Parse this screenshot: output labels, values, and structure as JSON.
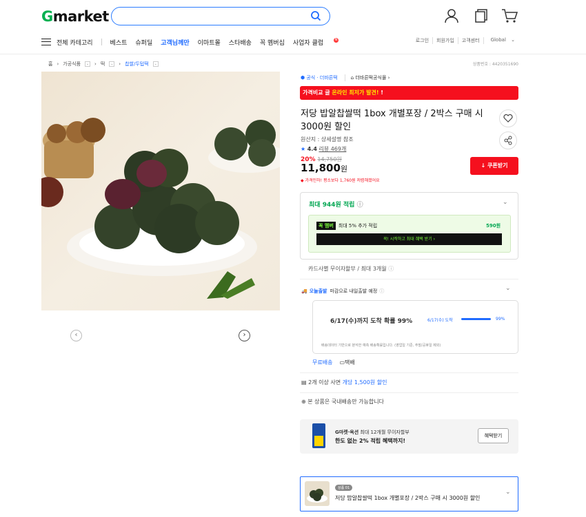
{
  "header": {
    "logo_g": "G",
    "logo_rest": "market",
    "search_placeholder": ""
  },
  "nav": {
    "all": "전체 카테고리",
    "items": [
      "베스트",
      "슈퍼딜",
      "고객님께만",
      "이마트몰",
      "스타배송",
      "꼭 멤버십",
      "사업자 클럽"
    ],
    "biz_badge": "N"
  },
  "util": [
    "로그인",
    "회원가입",
    "고객센터",
    "Global"
  ],
  "breadcrumb": [
    "홈",
    "가공식품",
    "떡",
    "찹쌀/두텁떡"
  ],
  "product_no": "상품번호 : 4420351690",
  "seller": {
    "badge": "공식 · 더바른떡",
    "shop": "더바른떡공식몰"
  },
  "banner": {
    "pre": "가격비교 글 ",
    "highlight": "온라인 최저가 발견!",
    "icon": "!"
  },
  "title": "저당 밥알찹쌀떡 1box 개별포장 / 2박스 구매 시 3000원 할인",
  "origin": "원산지 : 상세설명 참조",
  "rating": {
    "star": "★",
    "score": "4.4",
    "reviews": "리뷰 469개"
  },
  "price": {
    "discount": "20%",
    "original": "14,750원",
    "current": "11,800",
    "unit": "원",
    "lowest_note": "가격인하! 평소보다 1,760원 저렴해졌어요"
  },
  "coupon": "쿠폰받기",
  "points": {
    "title": "최대 944원 적립",
    "smile_logo": "꼭 멤버",
    "smile_text": "최대 5% 추가 적립",
    "smile_amount": "590원",
    "cta": "꼭! 시작하고 최대 혜택 받기 ›"
  },
  "card": "카드사별 무이자할부 / 최대 3개월",
  "delivery": {
    "tag": "오늘출발",
    "text": "마감으로 내일출발 예정",
    "headline": "6/17(수)까지 도착 확률 99%",
    "bar_label": "6/17(수) 도착",
    "bar_pct": "99%",
    "bar_value": 0.99,
    "note": "배송데이터 기반으로 분석한 예측 배송확률입니다. (영업일 기준, 주말/공휴일 제외)"
  },
  "shipping": {
    "free": "무료배송",
    "type": "택배"
  },
  "multi": {
    "pre": "2개 이상 사면 ",
    "hl": "개당 1,500원 할인"
  },
  "domestic": "본 상품은 국내배송만 가능합니다",
  "ad": {
    "line1_b": "G마켓·옥션",
    "line1": " 최대 12개월 무이자할부",
    "line2": "한도 없는 2% 적립 혜택까지!",
    "btn": "혜택받기"
  },
  "option": {
    "badge": "상품 01",
    "text": "저당 밥알찹쌀떡 1box 개별포장 / 2박스 구매 시 3000원 할인"
  },
  "colors": {
    "accent": "#1f6bff",
    "red": "#f5101e",
    "green": "#00a651"
  }
}
